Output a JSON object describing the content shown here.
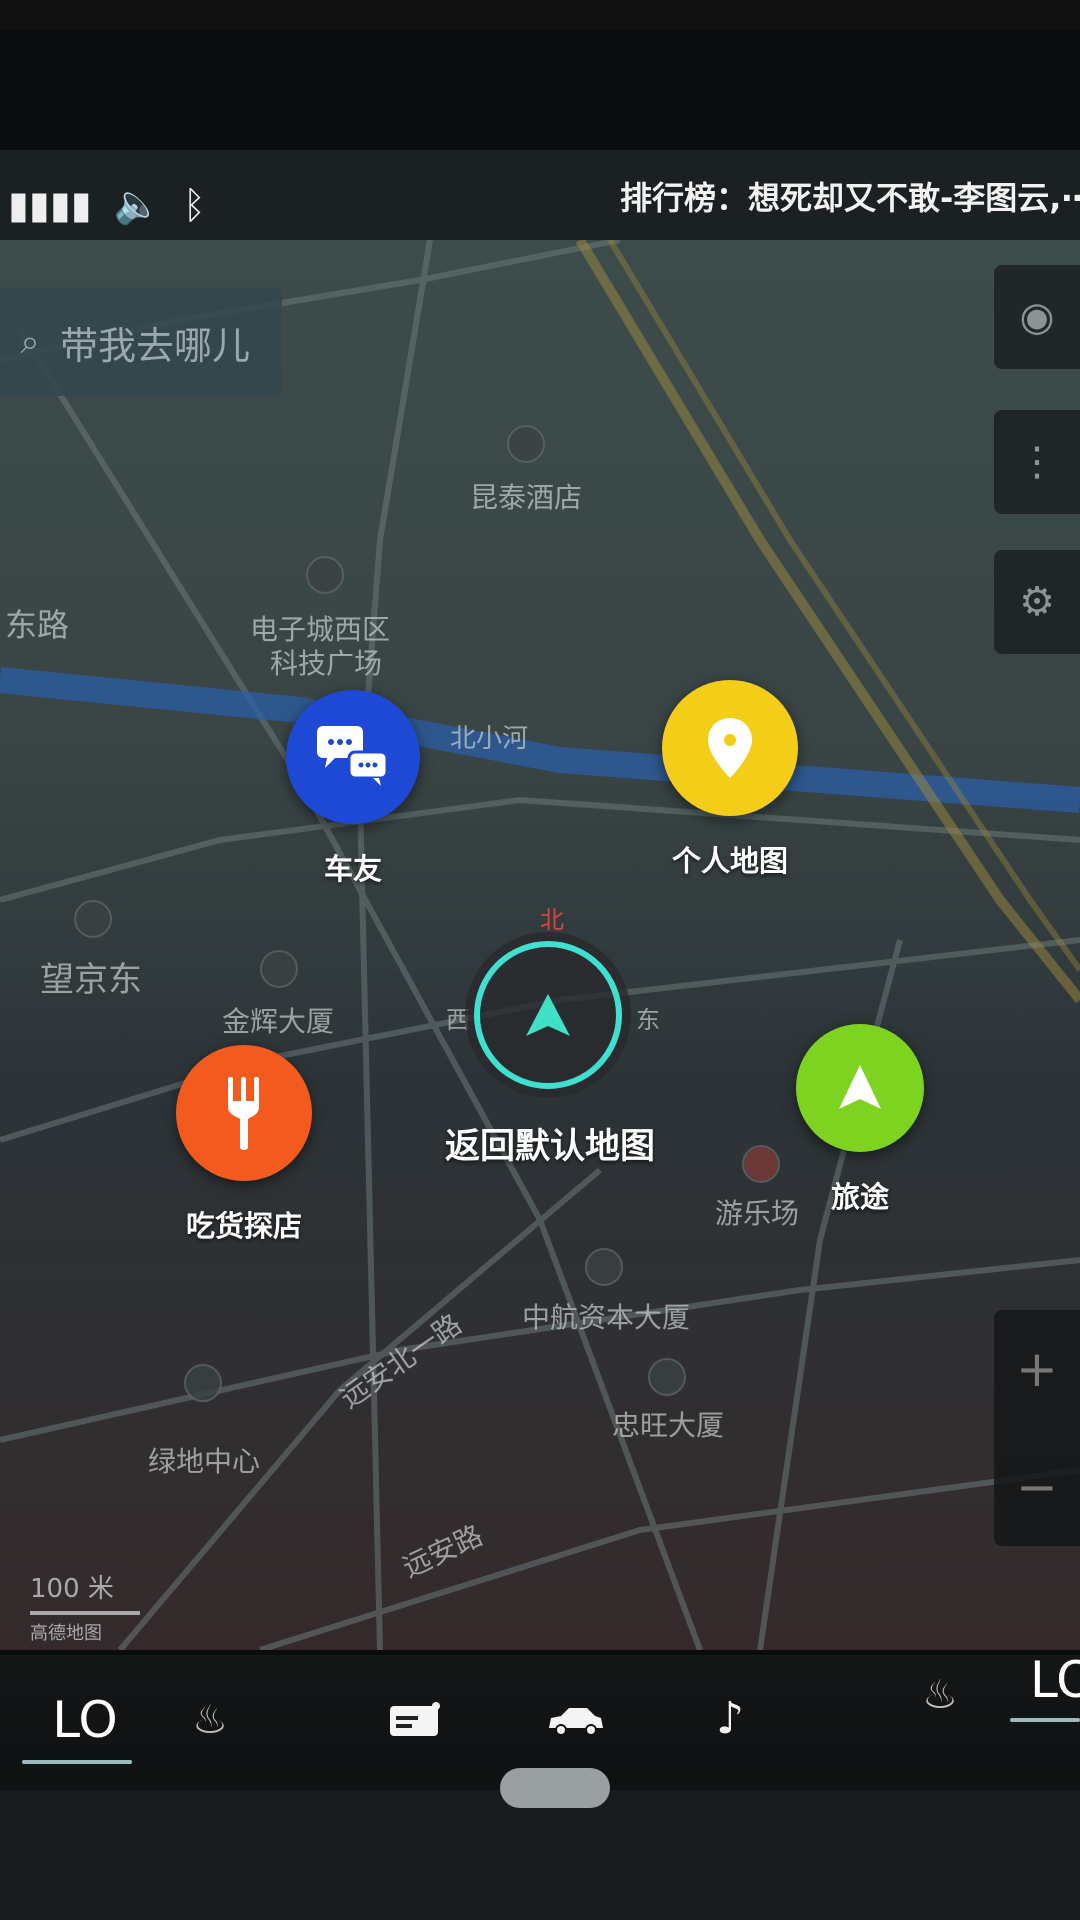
{
  "status": {
    "signal_icon": "signal-bars-icon",
    "volume_icon": "volume-icon",
    "bluetooth_icon": "bluetooth-icon",
    "now_playing": "排行榜：想死却又不敢-李图云,⋯"
  },
  "search": {
    "placeholder": "带我去哪儿"
  },
  "map_labels": {
    "hotel": "昆泰酒店",
    "tech_plaza_1": "电子城西区",
    "tech_plaza_2": "科技广场",
    "road_east": "东路",
    "river": "北小河",
    "station": "望京东",
    "jinhui": "金辉大厦",
    "amusement": "游乐场",
    "zhonghang": "中航资本大厦",
    "zhongwang": "忠旺大厦",
    "lvdi": "绿地中心",
    "yuanan_north": "远安北一路",
    "yuanan": "远安路",
    "north_marker": "北",
    "west_marker": "西",
    "east_marker": "东"
  },
  "menu": {
    "car_friends": "车友",
    "personal_map": "个人地图",
    "food_explore": "吃货探店",
    "journey": "旅途",
    "back_default": "返回默认地图"
  },
  "scale": {
    "value": "100 米",
    "provider": "高德地图"
  },
  "zoom": {
    "in": "+",
    "out": "−"
  },
  "bottom": {
    "left_temp": "LO",
    "right_temp": "LO",
    "seat_heat_icon": "seat-heat-icon",
    "card_icon": "card-icon",
    "car_icon": "car-icon",
    "music_icon": "music-note-icon"
  },
  "colors": {
    "car_friends": "#1e49d4",
    "personal_map": "#f3cd18",
    "food_explore": "#f25a1e",
    "journey": "#7ed320",
    "center_ring": "#3fe0d0"
  }
}
